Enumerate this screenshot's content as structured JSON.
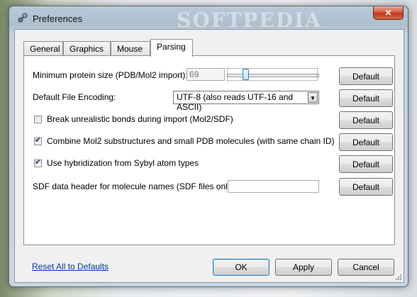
{
  "window": {
    "title": "Preferences",
    "watermark": "SOFTPEDIA",
    "close_glyph": "✕"
  },
  "tabs": [
    {
      "label": "General",
      "active": false
    },
    {
      "label": "Graphics",
      "active": false
    },
    {
      "label": "Mouse",
      "active": false
    },
    {
      "label": "Parsing",
      "active": true
    }
  ],
  "parsing": {
    "min_protein": {
      "label": "Minimum protein size (PDB/Mol2 import):",
      "value": "69"
    },
    "encoding": {
      "label": "Default File Encoding:",
      "selected": "UTF-8 (also reads UTF-16 and ASCII)",
      "arrow": "▼"
    },
    "break_bonds": {
      "label": "Break unrealistic bonds during import (Mol2/SDF)",
      "checked": false
    },
    "combine_mol2": {
      "label": "Combine Mol2 substructures and small PDB molecules (with same chain ID)",
      "checked": true
    },
    "hybridization": {
      "label": "Use hybridization from Sybyl atom types",
      "checked": true
    },
    "sdf_header": {
      "label": "SDF data header for molecule names (SDF files only)",
      "value": ""
    },
    "default_label": "Default"
  },
  "footer": {
    "reset_link": "Reset All to Defaults",
    "ok": "OK",
    "apply": "Apply",
    "cancel": "Cancel"
  },
  "check_glyph": "✔"
}
